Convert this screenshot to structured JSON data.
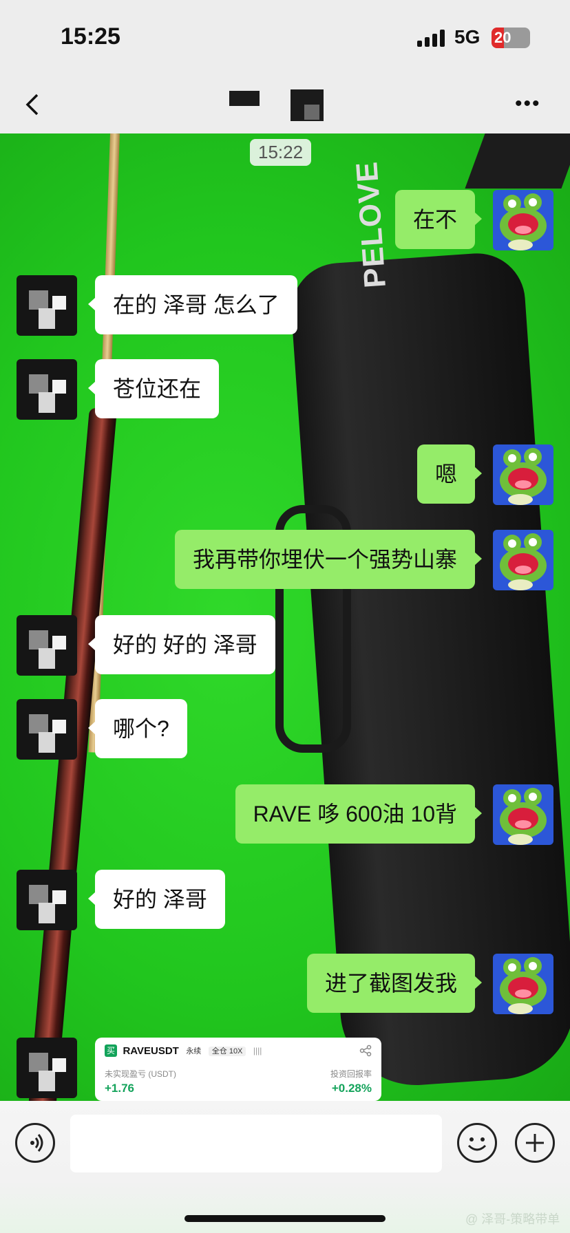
{
  "status_bar": {
    "time": "15:25",
    "network": "5G",
    "battery": "20"
  },
  "nav": {
    "back_icon": "chevron-left-icon",
    "more_icon": "ellipsis-icon",
    "title_redacted": true
  },
  "chat": {
    "timestamp": "15:22",
    "messages": [
      {
        "from": "me",
        "text": "在不"
      },
      {
        "from": "other",
        "text": "在的 泽哥 怎么了"
      },
      {
        "from": "other",
        "text": "苍位还在"
      },
      {
        "from": "me",
        "text": "嗯"
      },
      {
        "from": "me",
        "text": "我再带你埋伏一个强势山寨"
      },
      {
        "from": "other",
        "text": "好的 好的 泽哥"
      },
      {
        "from": "other",
        "text": "哪个?"
      },
      {
        "from": "me",
        "text": "RAVE 哆 600油 10背"
      },
      {
        "from": "other",
        "text": "好的 泽哥"
      },
      {
        "from": "me",
        "text": "进了截图发我"
      }
    ],
    "trade_card": {
      "tag": "买",
      "symbol": "RAVEUSDT",
      "type": "永续",
      "margin": "全仓 10X",
      "bars": "||||",
      "pnl_label": "未实现盈亏 (USDT)",
      "pnl_value": "+1.76",
      "roi_label": "投资回报率",
      "roi_value": "+0.28%"
    },
    "background_logo": "PELOVE"
  },
  "input_bar": {
    "placeholder": "",
    "voice_icon": "voice-icon",
    "emoji_icon": "emoji-icon",
    "plus_icon": "plus-icon"
  },
  "watermark": "@ 泽哥-策略带单",
  "colors": {
    "bubble_me": "#95ec69",
    "bubble_other": "#ffffff",
    "profit": "#14a35b"
  }
}
